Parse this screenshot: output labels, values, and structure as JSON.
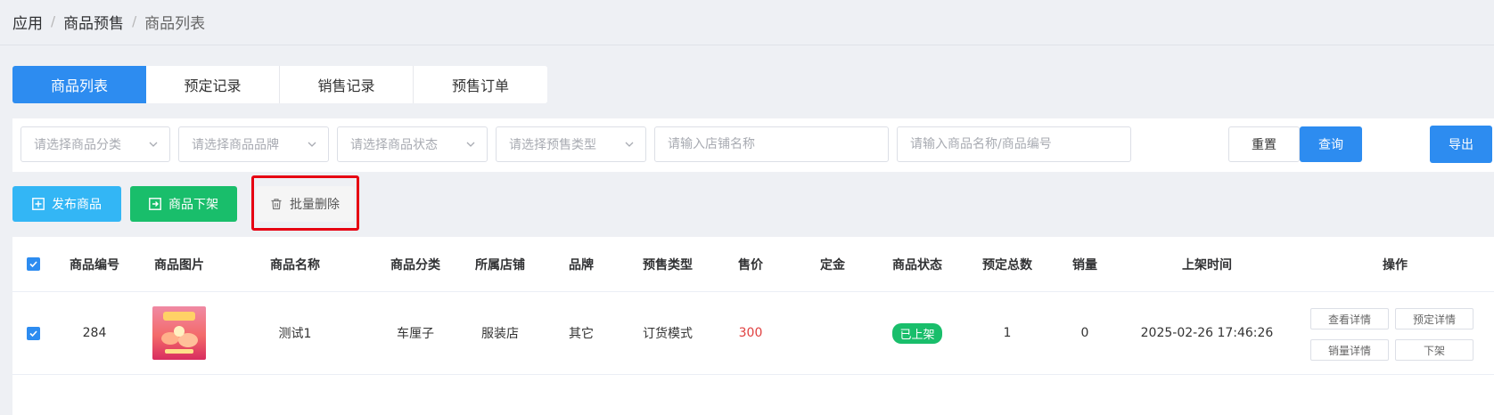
{
  "breadcrumb": {
    "items": [
      "应用",
      "商品预售",
      "商品列表"
    ],
    "sep": "/"
  },
  "tabs": [
    {
      "label": "商品列表",
      "active": true
    },
    {
      "label": "预定记录",
      "active": false
    },
    {
      "label": "销售记录",
      "active": false
    },
    {
      "label": "预售订单",
      "active": false
    }
  ],
  "filters": {
    "category_placeholder": "请选择商品分类",
    "brand_placeholder": "请选择商品品牌",
    "status_placeholder": "请选择商品状态",
    "presale_type_placeholder": "请选择预售类型",
    "shop_placeholder": "请输入店铺名称",
    "keyword_placeholder": "请输入商品名称/商品编号",
    "reset_label": "重置",
    "query_label": "查询",
    "export_label": "导出"
  },
  "actions": {
    "publish_label": "发布商品",
    "offline_label": "商品下架",
    "batch_delete_label": "批量删除"
  },
  "table": {
    "columns": [
      "商品编号",
      "商品图片",
      "商品名称",
      "商品分类",
      "所属店铺",
      "品牌",
      "预售类型",
      "售价",
      "定金",
      "商品状态",
      "预定总数",
      "销量",
      "上架时间",
      "操作"
    ],
    "rows": [
      {
        "id": "284",
        "name": "测试1",
        "category": "车厘子",
        "shop": "服装店",
        "brand": "其它",
        "presale_type": "订货模式",
        "price": "300",
        "deposit": "",
        "status": "已上架",
        "reserved_total": "1",
        "sales": "0",
        "listed_at": "2025-02-26 17:46:26",
        "ops": [
          "查看详情",
          "预定详情",
          "销量详情",
          "下架"
        ]
      }
    ]
  },
  "colors": {
    "primary": "#2d8cf0",
    "publish": "#33b6f5",
    "success": "#19be6b",
    "price": "#e04040",
    "highlight": "#e60012"
  }
}
